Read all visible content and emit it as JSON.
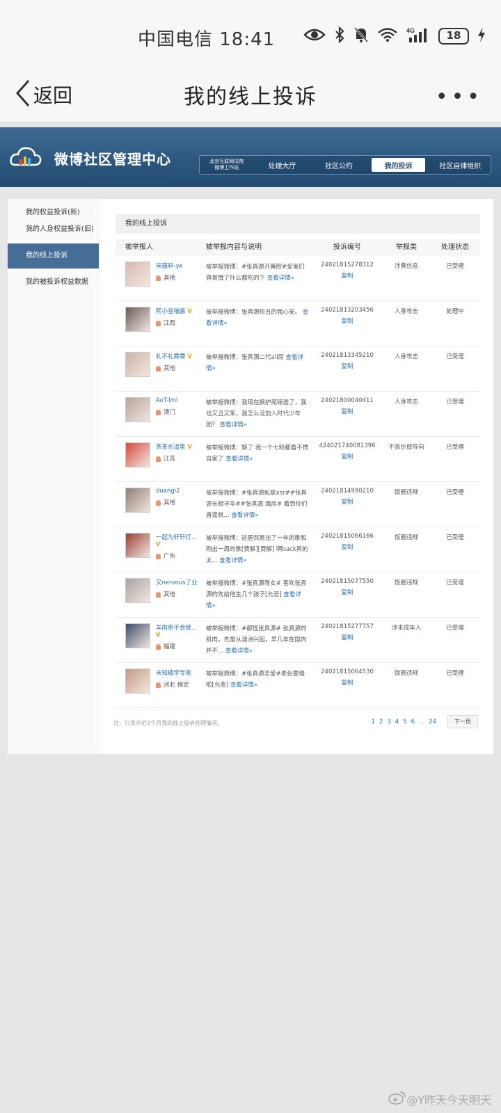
{
  "statusbar": {
    "carrier_time": "中国电信 18:41",
    "battery": "18"
  },
  "navbar": {
    "back_label": "返回",
    "title": "我的线上投诉"
  },
  "banner": {
    "site_name": "微博社区管理中心",
    "org_line1": "北京互联网法院",
    "org_line2": "微博工作站",
    "tabs": [
      "处理大厅",
      "社区公约",
      "我的投诉",
      "社区自律组织"
    ]
  },
  "sidebar": {
    "items": [
      "我的权益投诉(新)",
      "我的人身权益投诉(旧)",
      "我的线上投诉",
      "我的被投诉权益数据"
    ]
  },
  "main": {
    "section_title": "我的线上投诉",
    "columns": [
      "被举报人",
      "被举报内容与说明",
      "投诉编号",
      "举报类",
      "处理状态"
    ],
    "copy_label": "复制",
    "rows": [
      {
        "user": "宋蕴轩-yx",
        "verified": false,
        "location": "其他",
        "desc": "被举报微博：#张真源开黄腔#爱害们真是饿了什么都吃的下",
        "link": "查看详情»",
        "id": "24021815278312",
        "type": "涉黄信息",
        "status": "已受理",
        "avatar_color": "#d9b9b0"
      },
      {
        "user": "阿小皇喵酱",
        "verified": true,
        "location": "江西",
        "desc": "被举报微博：张真源你丑的我心安。",
        "link": "查看详情»",
        "id": "24021813203456",
        "type": "人身攻击",
        "status": "处理中",
        "avatar_color": "#6b5a55"
      },
      {
        "user": "礼不礼霖霖",
        "verified": true,
        "location": "其他",
        "desc": "被举报微博：张真源二代all屌",
        "link": "查看详情»",
        "id": "24021813345210",
        "type": "人身攻击",
        "status": "已受理",
        "avatar_color": "#cfb2a8"
      },
      {
        "user": "AoT-lml",
        "verified": false,
        "location": "澳门",
        "desc": "被举报微博：我现在摘护苑锦透了，我也又丑又笨，我怎么没加入时代少年团？",
        "link": "查看详情»",
        "id": "24021800040411",
        "type": "人身攻击",
        "status": "已受理",
        "avatar_color": "#b7a39d"
      },
      {
        "user": "茶茶也追星",
        "verified": true,
        "location": "江苏",
        "desc": "被举报微博：够了 我一个七粉都看不惯自家了",
        "link": "查看详情»",
        "id": "424021740081396",
        "type": "不良价值导向",
        "status": "已受理",
        "avatar_color": "#d84a3e"
      },
      {
        "user": "duangi2",
        "verified": false,
        "location": "其他",
        "desc": "被举报微博：#张真源私联xsr##张真源长相寻华##张真源 塌房# 看到你们直接就...",
        "link": "查看详情»",
        "id": "24021814990210",
        "type": "饭圈违规",
        "status": "已受理",
        "avatar_color": "#8e7d76"
      },
      {
        "user": "一起为轩轩打...",
        "verified": true,
        "location": "广东",
        "desc": "被举报微博：这居然是出了一年的歌和刚出一周的歌[费解][费解] 啊back真的太...",
        "link": "查看详情»",
        "id": "24021815066166",
        "type": "饭圈违规",
        "status": "已受理",
        "avatar_color": "#9a3f35"
      },
      {
        "user": "又nervous了业",
        "verified": false,
        "location": "其他",
        "desc": "被举报微博：#张真源辱女# 喜欢张真源的先给他生几个孩子[允悲]",
        "link": "查看详情»",
        "id": "24021815077550",
        "type": "饭圈违规",
        "status": "已受理",
        "avatar_color": "#a9a4a2"
      },
      {
        "user": "羊肉串不会就...",
        "verified": true,
        "location": "福建",
        "desc": "被举报微博：#都怪张真源# 张真源的肌肉，先是从澳洲兴起，早几年在国内并不...",
        "link": "查看详情»",
        "id": "24021815277757",
        "type": "涉未成年人",
        "status": "已受理",
        "avatar_color": "#3e4e6e"
      },
      {
        "user": "未知磕学专家",
        "verified": false,
        "location": "河北 保定",
        "desc": "被举报微博：#张真源恋爱#老张要塌啦[允悲]",
        "link": "查看详情»",
        "id": "24021815064530",
        "type": "饭圈违规",
        "status": "已受理",
        "avatar_color": "#c49a84"
      }
    ]
  },
  "footer": {
    "note": "注：只显示近3个月我的线上投诉处理情况。",
    "pages": [
      "1",
      "2",
      "3",
      "4",
      "5",
      "6",
      "...",
      "24"
    ],
    "next_label": "下一页"
  },
  "watermark": "@Y昨天今天明天"
}
